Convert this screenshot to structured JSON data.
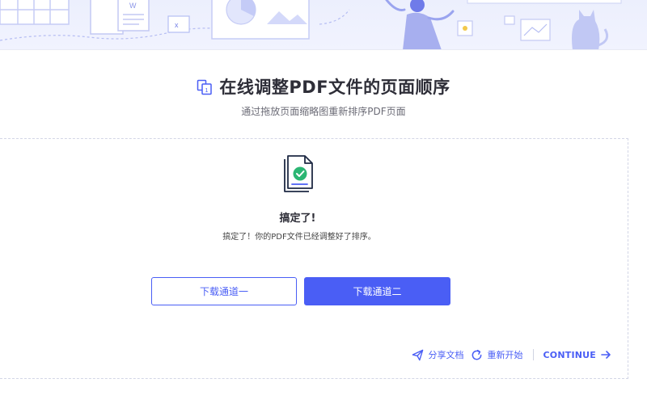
{
  "header": {
    "title": "在线调整PDF文件的页面顺序",
    "subtitle": "通过拖放页面缩略图重新排序PDF页面"
  },
  "result": {
    "title": "搞定了!",
    "message": "搞定了！你的PDF文件已经调整好了排序。"
  },
  "buttons": {
    "download_1": "下载通道一",
    "download_2": "下载通道二"
  },
  "actions": {
    "share": "分享文档",
    "restart": "重新开始",
    "continue": "CONTINUE"
  },
  "colors": {
    "accent": "#4a5ef5",
    "banner_bg": "#eceffd",
    "check_green": "#2bb673"
  },
  "icons": {
    "title": "reorder-pages-icon",
    "result": "file-done-icon",
    "share": "send-icon",
    "restart": "refresh-icon",
    "continue": "arrow-right-icon"
  }
}
